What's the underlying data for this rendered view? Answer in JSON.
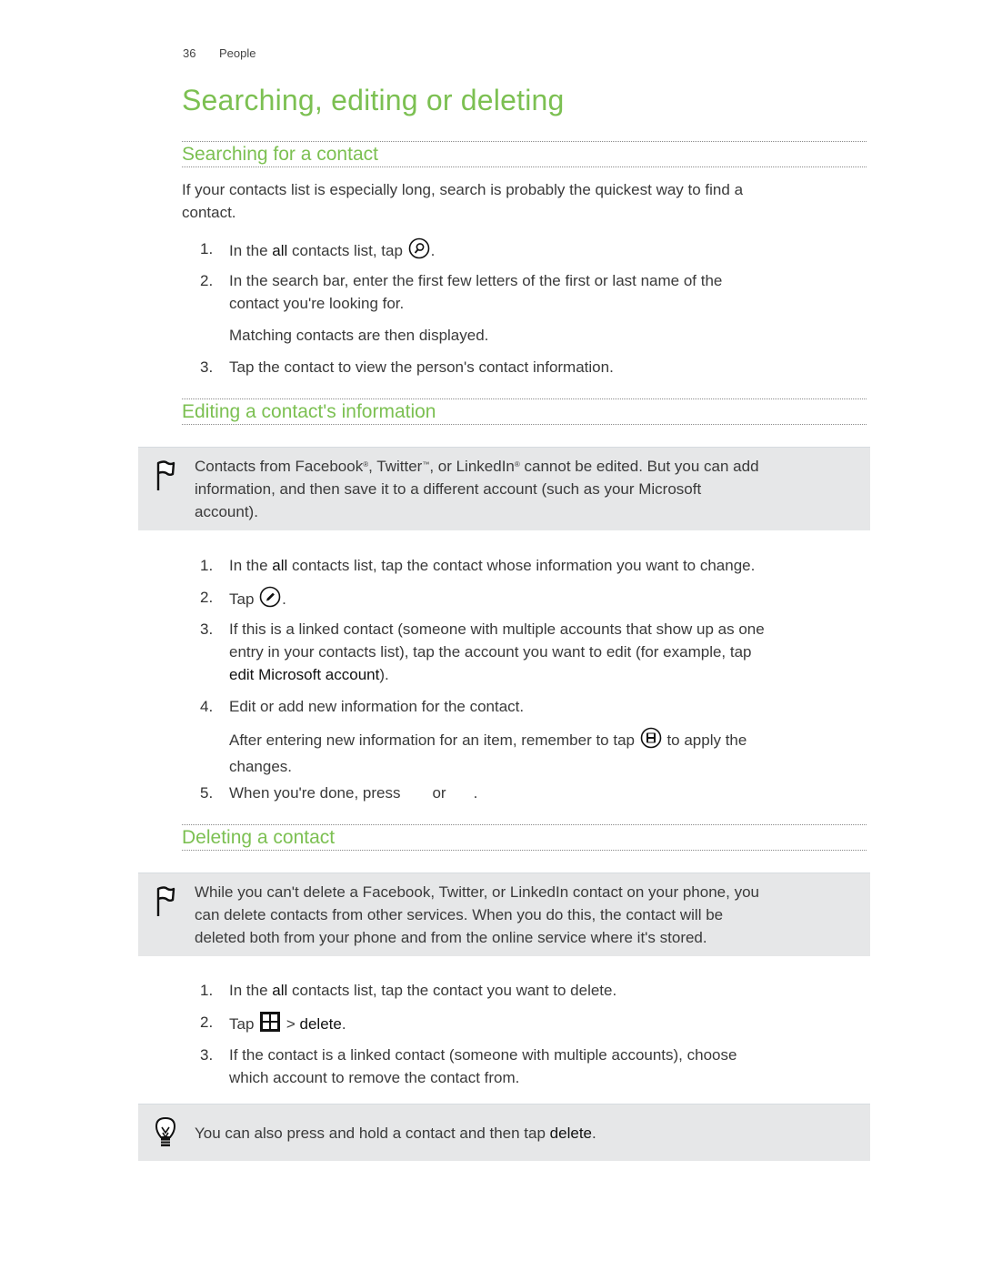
{
  "header": {
    "page_number": "36",
    "chapter": "People"
  },
  "title": "Searching, editing or deleting",
  "sections": {
    "search": {
      "heading": "Searching for a contact",
      "intro_line1": "If your contacts list is especially long, search is probably the quickest way to find a",
      "intro_line2": "contact.",
      "steps": [
        {
          "num": "1.",
          "pre": "In the ",
          "bold": "all",
          "post": " contacts list, tap ",
          "icon": "search-icon",
          "end": "."
        },
        {
          "num": "2.",
          "line1": "In the search bar, enter the first few letters of the first or last name of the",
          "line2": "contact you're looking for."
        },
        {
          "num": "3.",
          "text": "Tap the contact to view the person's contact information."
        }
      ],
      "sub_note": "Matching contacts are then displayed."
    },
    "edit": {
      "heading": "Editing a contact's information",
      "note": {
        "icon": "flag-icon",
        "p1": "Contacts from Facebook",
        "reg": "®",
        "p2": ", Twitter",
        "tm": "™",
        "p3": ", or LinkedIn",
        "p4": " cannot be edited. But you can add",
        "line2": "information, and then save it to a different account (such as your Microsoft",
        "line3": "account)."
      },
      "steps": [
        {
          "num": "1.",
          "pre": "In the ",
          "bold": "all",
          "post": " contacts list, tap the contact whose information you want to change."
        },
        {
          "num": "2.",
          "pre": "Tap ",
          "icon": "edit-pencil-icon",
          "end": "."
        },
        {
          "num": "3.",
          "line1": "If this is a linked contact (someone with multiple accounts that show up as one",
          "line2": "entry in your contacts list), tap the account you want to edit (for example, tap",
          "bold": "edit Microsoft account",
          "end": ")."
        },
        {
          "num": "4.",
          "text": "Edit or add new information for the contact."
        },
        {
          "num": "5.",
          "pre": "When you're done, press",
          "mid": "or",
          "end": "."
        }
      ],
      "sub_note_pre": "After entering new information for an item, remember to tap ",
      "sub_note_icon": "save-icon",
      "sub_note_post": " to apply the",
      "sub_note_line2": "changes."
    },
    "delete": {
      "heading": "Deleting a contact",
      "note": {
        "icon": "flag-icon",
        "line1": "While you can't delete a Facebook, Twitter, or LinkedIn contact on your phone, you",
        "line2": "can delete contacts from other services. When you do this, the contact will be",
        "line3": "deleted both from your phone and from the online service where it's stored."
      },
      "steps": [
        {
          "num": "1.",
          "pre": "In the ",
          "bold": "all",
          "post": " contacts list, tap the contact you want to delete."
        },
        {
          "num": "2.",
          "pre": "Tap ",
          "icon": "windows-start-icon",
          "sep": " > ",
          "bold": "delete",
          "end": "."
        },
        {
          "num": "3.",
          "line1": "If the contact is a linked contact (someone with multiple accounts), choose",
          "line2": "which account to remove the contact from."
        }
      ],
      "tip": {
        "icon": "lightbulb-icon",
        "pre": "You can also press and hold a contact and then tap ",
        "bold": "delete",
        "end": "."
      }
    }
  },
  "colors": {
    "accent_green": "#7cc052",
    "note_bg": "#e6e7e8",
    "text": "#3a3a3a"
  }
}
